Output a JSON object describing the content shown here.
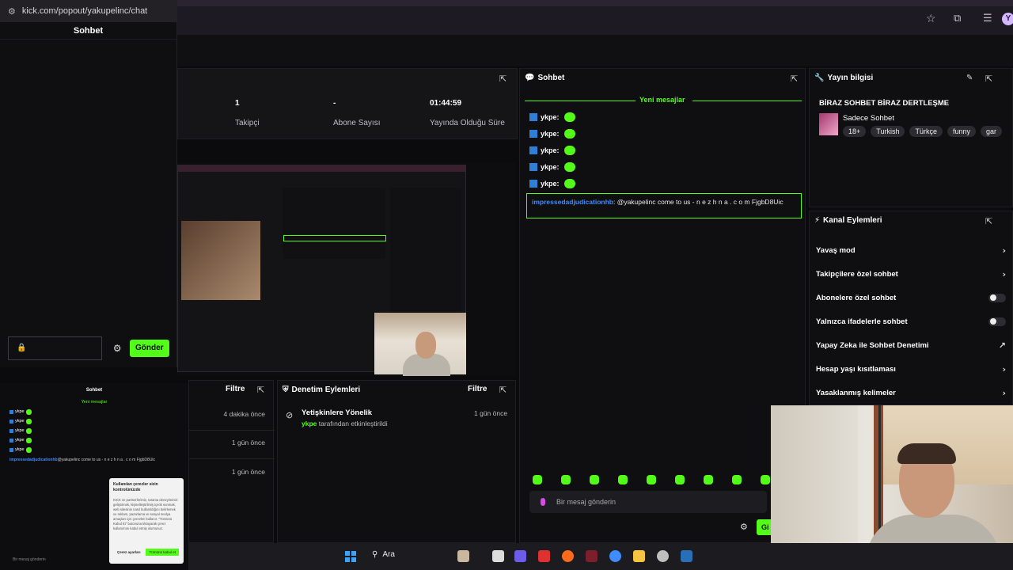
{
  "browser": {
    "url": "kick.com/popout/yakupelinc/chat",
    "avatar_letter": "Y"
  },
  "popout": {
    "title": "Sohbet",
    "input_icon": "lock-icon",
    "send_label": "Gönder"
  },
  "stats": [
    {
      "value": "1",
      "label": "Takipçi"
    },
    {
      "value": "-",
      "label": "Abone Sayısı"
    },
    {
      "value": "01:44:59",
      "label": "Yayında Olduğu Süre"
    }
  ],
  "chat": {
    "title": "Sohbet",
    "new_messages": "Yeni mesajlar",
    "messages": [
      {
        "user": "ykpe:"
      },
      {
        "user": "ykpe:"
      },
      {
        "user": "ykpe:"
      },
      {
        "user": "ykpe:"
      },
      {
        "user": "ykpe:"
      }
    ],
    "spam_user": "impressedadjudicationhb",
    "spam_text": ": @yakupelinc come to us - n e z h n a . c o m FjgbD8Uic",
    "input_placeholder": "Bir mesaj gönderin",
    "send_partial": "Gi"
  },
  "stream_info": {
    "title": "Yayın bilgisi",
    "stream_title": "BİRAZ SOHBET BİRAZ DERTLEŞME",
    "category": "Sadece Sohbet",
    "tags": [
      "18+",
      "Turkish",
      "Türkçe",
      "funny",
      "gar"
    ]
  },
  "channel_actions": {
    "title": "Kanal Eylemleri",
    "items": [
      {
        "label": "Yavaş mod",
        "control": "chevron"
      },
      {
        "label": "Takipçilere özel sohbet",
        "control": "chevron"
      },
      {
        "label": "Abonelere özel sohbet",
        "control": "toggle"
      },
      {
        "label": "Yalnızca ifadelerle sohbet",
        "control": "toggle"
      },
      {
        "label": "Yapay Zeka ile Sohbet Denetimi",
        "control": "external"
      },
      {
        "label": "Hesap yaşı kısıtlaması",
        "control": "chevron"
      },
      {
        "label": "Yasaklanmış kelimeler",
        "control": "chevron"
      }
    ]
  },
  "moderation": {
    "title": "Denetim Eylemleri",
    "filter": "Filtre",
    "entry_title": "Yetişkinlere Yönelik",
    "entry_user": "ykpe",
    "entry_suffix": " tarafından etkinleştirildi",
    "entry_time": "1 gün önce"
  },
  "activity": {
    "filter": "Filtre",
    "times": [
      "4 dakika önce",
      "1 gün önce",
      "1 gün önce"
    ]
  },
  "mini_popout": {
    "title": "Sohbet",
    "new_messages": "Yeni mesajlar",
    "user": "ykpe",
    "spam_user": "impressedadjudicationhb",
    "spam_text": "@yakupelinc come to us - n e z h n a . c o m FjgbD8Uic",
    "cookie_title": "Kullanılan çerezler sizin kontrolünüzde",
    "cookie_body": "KICK ve partnerlerimiz, tarama deneyiminizi geliştirmek, kişiselleştirilmiş içerik sunmak, web sitesinin nasıl kullanıldığını belirlemek ve reklam, pazarlama ve sosyal medya amaçları için çerezleri kullanır. \"Tümünü Kabul Et\" butonuna tıklayarak çerez kullanımını kabul etmiş olursunuz.",
    "cookie_accept": "Tümünü kabul et",
    "cookie_settings": "Çerez ayarları",
    "input_placeholder": "Bir mesaj gönderin"
  },
  "taskbar": {
    "search_label": "Ara"
  },
  "colors": {
    "accent": "#53fc18",
    "link": "#3d8bff",
    "panel": "#0f0f11"
  }
}
